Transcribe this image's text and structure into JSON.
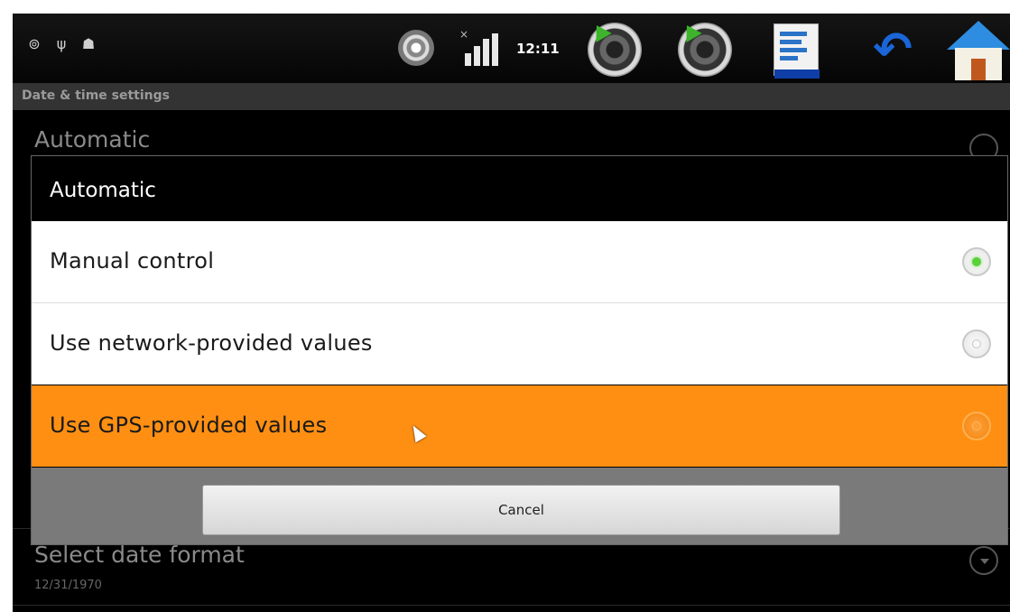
{
  "status_bar": {
    "clock": "12:11",
    "left_icons": [
      "sync-icon",
      "usb-icon",
      "android-debug-icon"
    ],
    "right_icons": [
      "gps-icon",
      "signal-icon",
      "speaker-icon",
      "speaker-icon",
      "document-icon",
      "back-icon",
      "home-icon"
    ],
    "signal_mark": "×"
  },
  "screen": {
    "title": "Date & time settings",
    "automatic_label": "Automatic",
    "select_date_format_label": "Select date format",
    "date_format_value": "12/31/1970"
  },
  "dialog": {
    "title": "Automatic",
    "options": [
      {
        "label": "Manual control",
        "state": "selected"
      },
      {
        "label": "Use network-provided values",
        "state": "unselected"
      },
      {
        "label": "Use GPS-provided values",
        "state": "highlighted"
      }
    ],
    "cancel_label": "Cancel"
  },
  "colors": {
    "highlight": "#ff8f12",
    "selected_radio": "#5ad13a",
    "dialog_footer": "#7a7a7a"
  }
}
